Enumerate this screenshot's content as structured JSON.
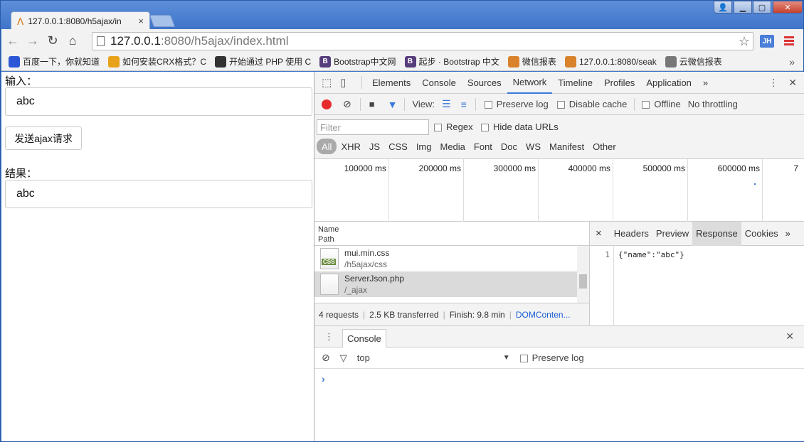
{
  "browser": {
    "tab_title": "127.0.0.1:8080/h5ajax/in",
    "tab_close": "×",
    "url_host": "127.0.0.1",
    "url_rest": ":8080/h5ajax/index.html",
    "ext_label": "JH"
  },
  "bookmarks": [
    {
      "label": "百度一下，你就知道",
      "icon": "paw-icon",
      "color": "#2b57d6"
    },
    {
      "label": "如何安装CRX格式？C",
      "icon": "chrome-icon",
      "color": "#e8a21a"
    },
    {
      "label": "开始通过 PHP 使用 C",
      "icon": "cloud-icon",
      "color": "#333333"
    },
    {
      "label": "Bootstrap中文网",
      "icon": "bootstrap-icon",
      "color": "#563d7c"
    },
    {
      "label": "起步 · Bootstrap 中文",
      "icon": "bootstrap-icon",
      "color": "#563d7c"
    },
    {
      "label": "微信报表",
      "icon": "wave-icon",
      "color": "#d9822b"
    },
    {
      "label": "127.0.0.1:8080/seak",
      "icon": "wave-icon",
      "color": "#d9822b"
    },
    {
      "label": "云微信报表",
      "icon": "page-icon",
      "color": "#777777"
    }
  ],
  "page": {
    "input_label": "输入：",
    "input_value": "abc",
    "send_button": "发送ajax请求",
    "result_label": "结果：",
    "result_value": "abc"
  },
  "devtools": {
    "tabs": [
      "Elements",
      "Console",
      "Sources",
      "Network",
      "Timeline",
      "Profiles",
      "Application"
    ],
    "active_tab": "Network",
    "more": "»",
    "close": "✕",
    "view_label": "View:",
    "preserve_log": "Preserve log",
    "disable_cache": "Disable cache",
    "offline": "Offline",
    "throttling": "No throttling",
    "filter_placeholder": "Filter",
    "regex": "Regex",
    "hide_data_urls": "Hide data URLs",
    "types": [
      "All",
      "XHR",
      "JS",
      "CSS",
      "Img",
      "Media",
      "Font",
      "Doc",
      "WS",
      "Manifest",
      "Other"
    ],
    "ticks": [
      "100000 ms",
      "200000 ms",
      "300000 ms",
      "400000 ms",
      "500000 ms",
      "600000 ms",
      "7"
    ],
    "col_name": "Name",
    "col_path": "Path",
    "requests": [
      {
        "name": "mui.min.css",
        "path": "/h5ajax/css",
        "icon": "css-file-icon",
        "badge": "CSS"
      },
      {
        "name": "ServerJson.php",
        "path": "/_ajax",
        "icon": "file-icon",
        "badge": ""
      }
    ],
    "summary": {
      "requests": "4 requests",
      "transferred": "2.5 KB transferred",
      "finish": "Finish: 9.8 min",
      "dcl": "DOMConten..."
    },
    "detail_tabs": [
      "Headers",
      "Preview",
      "Response",
      "Cookies"
    ],
    "active_detail": "Response",
    "detail_close": "×",
    "line_no": "1",
    "response_text": "{\"name\":\"abc\"}",
    "drawer_tab": "Console",
    "context": "top",
    "drawer_preserve_log": "Preserve log",
    "prompt": "›"
  }
}
